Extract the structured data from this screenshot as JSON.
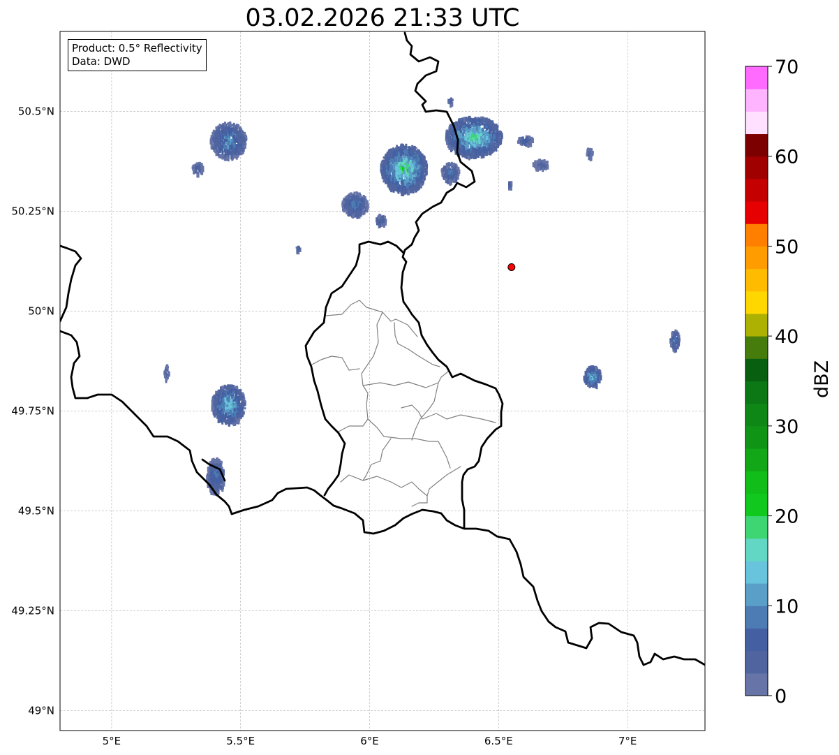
{
  "title": "03.02.2026 21:33 UTC",
  "info": {
    "product": "Product: 0.5° Reflectivity",
    "data": "Data: DWD"
  },
  "map": {
    "lon_range": [
      4.8,
      7.3
    ],
    "lat_range": [
      48.95,
      50.7
    ],
    "lon_ticks": [
      {
        "value": 5.0,
        "label": "5°E"
      },
      {
        "value": 5.5,
        "label": "5.5°E"
      },
      {
        "value": 6.0,
        "label": "6°E"
      },
      {
        "value": 6.5,
        "label": "6.5°E"
      },
      {
        "value": 7.0,
        "label": "7°E"
      }
    ],
    "lat_ticks": [
      {
        "value": 49.0,
        "label": "49°N"
      },
      {
        "value": 49.25,
        "label": "49.25°N"
      },
      {
        "value": 49.5,
        "label": "49.5°N"
      },
      {
        "value": 49.75,
        "label": "49.75°N"
      },
      {
        "value": 50.0,
        "label": "50°N"
      },
      {
        "value": 50.25,
        "label": "50.25°N"
      },
      {
        "value": 50.5,
        "label": "50.5°N"
      }
    ],
    "radar_site": {
      "lon": 6.55,
      "lat": 50.11,
      "color": "#ff0000"
    },
    "echo_cells": [
      {
        "lon": 5.45,
        "lat": 50.43,
        "rlon": 0.07,
        "rlat": 0.045,
        "peak": 14
      },
      {
        "lon": 5.33,
        "lat": 50.36,
        "rlon": 0.022,
        "rlat": 0.015,
        "peak": 8
      },
      {
        "lon": 6.13,
        "lat": 50.36,
        "rlon": 0.09,
        "rlat": 0.06,
        "peak": 24
      },
      {
        "lon": 6.4,
        "lat": 50.44,
        "rlon": 0.11,
        "rlat": 0.05,
        "peak": 22
      },
      {
        "lon": 6.31,
        "lat": 50.35,
        "rlon": 0.035,
        "rlat": 0.025,
        "peak": 12
      },
      {
        "lon": 5.94,
        "lat": 50.27,
        "rlon": 0.05,
        "rlat": 0.03,
        "peak": 12
      },
      {
        "lon": 6.04,
        "lat": 50.23,
        "rlon": 0.02,
        "rlat": 0.015,
        "peak": 10
      },
      {
        "lon": 6.6,
        "lat": 50.43,
        "rlon": 0.03,
        "rlat": 0.012,
        "peak": 8
      },
      {
        "lon": 6.66,
        "lat": 50.37,
        "rlon": 0.03,
        "rlat": 0.012,
        "peak": 8
      },
      {
        "lon": 6.31,
        "lat": 50.53,
        "rlon": 0.01,
        "rlat": 0.008,
        "peak": 6
      },
      {
        "lon": 5.45,
        "lat": 49.77,
        "rlon": 0.065,
        "rlat": 0.05,
        "peak": 18
      },
      {
        "lon": 5.4,
        "lat": 49.59,
        "rlon": 0.035,
        "rlat": 0.045,
        "peak": 12
      },
      {
        "lon": 5.21,
        "lat": 49.85,
        "rlon": 0.01,
        "rlat": 0.02,
        "peak": 6
      },
      {
        "lon": 6.86,
        "lat": 49.84,
        "rlon": 0.035,
        "rlat": 0.025,
        "peak": 20
      },
      {
        "lon": 7.18,
        "lat": 49.93,
        "rlon": 0.018,
        "rlat": 0.025,
        "peak": 12
      },
      {
        "lon": 6.85,
        "lat": 50.4,
        "rlon": 0.012,
        "rlat": 0.012,
        "peak": 6
      },
      {
        "lon": 5.72,
        "lat": 50.16,
        "rlon": 0.007,
        "rlat": 0.008,
        "peak": 6
      },
      {
        "lon": 6.54,
        "lat": 50.32,
        "rlon": 0.008,
        "rlat": 0.01,
        "peak": 6
      }
    ]
  },
  "colorbar": {
    "label": "dBZ",
    "min": 0,
    "max": 70,
    "step": 2.5,
    "ticks": [
      0,
      10,
      20,
      30,
      40,
      50,
      60,
      70
    ],
    "colors": [
      "#6674a8",
      "#5065a0",
      "#4460a2",
      "#4d7cb4",
      "#5a9fc7",
      "#68c3dd",
      "#62d7c4",
      "#3ed672",
      "#10c81e",
      "#11bd18",
      "#12a716",
      "#0f9416",
      "#0e8716",
      "#0b7715",
      "#085f0f",
      "#467c0b",
      "#acb102",
      "#ffd700",
      "#ffbb00",
      "#ff9c00",
      "#ff7f00",
      "#e60002",
      "#c40000",
      "#a10000",
      "#7d0000",
      "#ffe0ff",
      "#ffb4ff",
      "#ff6aff",
      "#f03ef0"
    ]
  }
}
